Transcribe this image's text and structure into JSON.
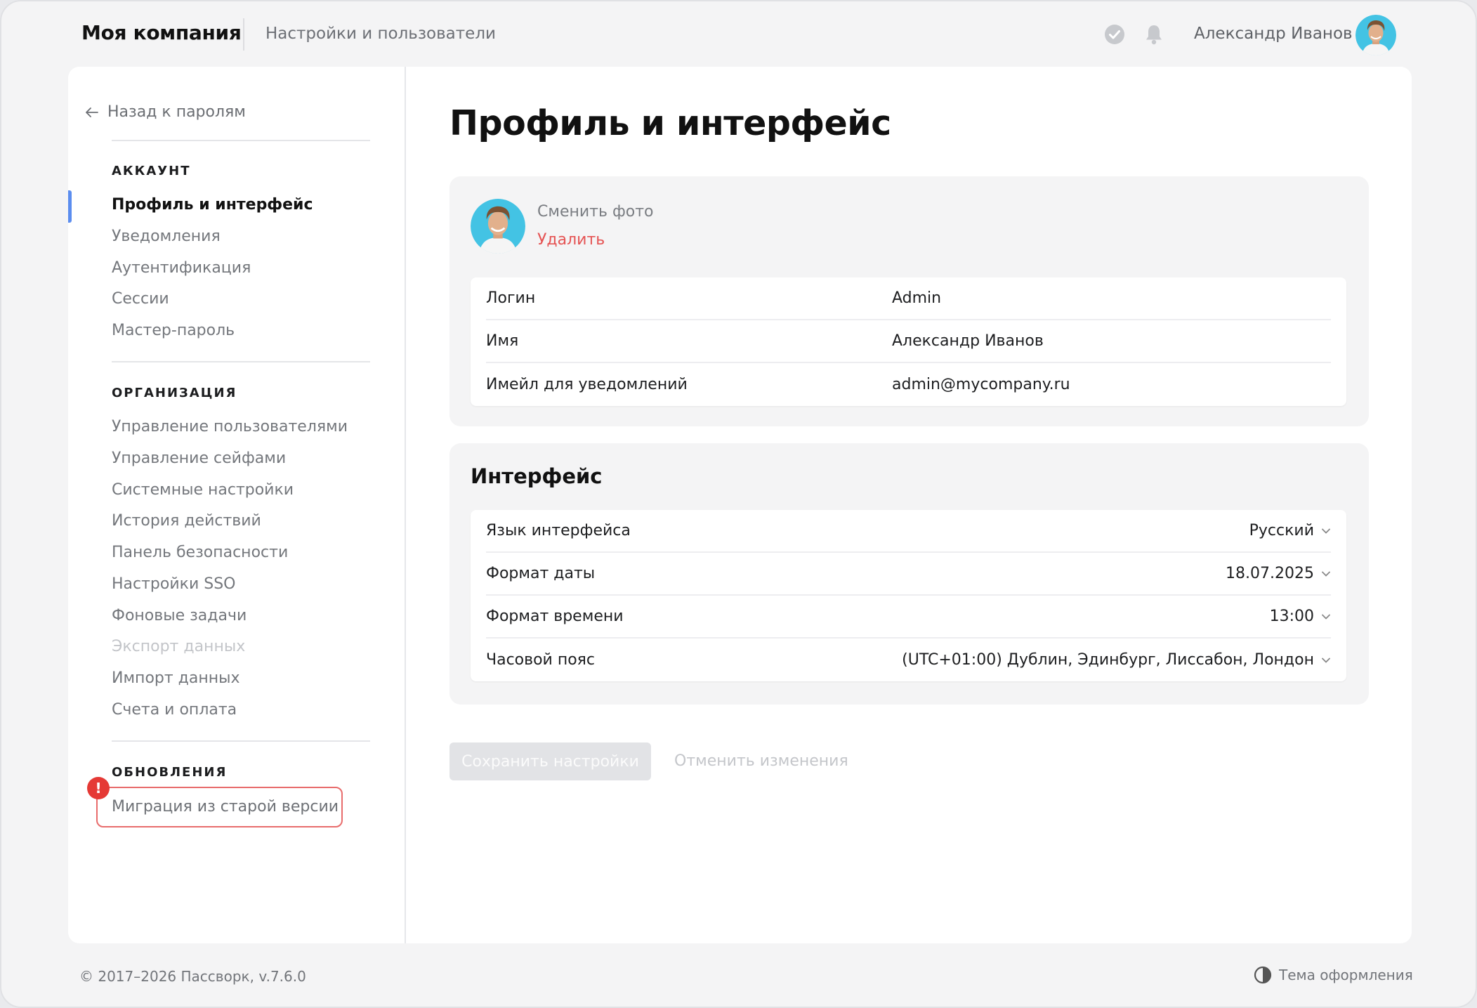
{
  "header": {
    "brand": "Моя компания",
    "subtitle": "Настройки и пользователи",
    "user_name": "Александр Иванов",
    "icons": [
      "check-circle-icon",
      "bell-icon",
      "avatar"
    ]
  },
  "sidebar": {
    "back_label": "Назад к паролям",
    "sections": {
      "account": {
        "title": "АККАУНТ",
        "items": [
          "Профиль и интерфейс",
          "Уведомления",
          "Аутентификация",
          "Сессии",
          "Мастер-пароль"
        ],
        "active_index": 0
      },
      "organization": {
        "title": "ОРГАНИЗАЦИЯ",
        "items": [
          "Управление пользователями",
          "Управление сейфами",
          "Системные настройки",
          "История действий",
          "Панель безопасности",
          "Настройки SSO",
          "Фоновые задачи",
          "Экспорт данных",
          "Импорт данных",
          "Счета и оплата"
        ],
        "disabled_index": 7
      },
      "updates": {
        "title": "ОБНОВЛЕНИЯ",
        "items": [
          "Миграция из старой версии"
        ],
        "badge": "!"
      }
    }
  },
  "main": {
    "title": "Профиль и интерфейс",
    "profile": {
      "change_photo": "Сменить фото",
      "delete_photo": "Удалить",
      "fields": [
        {
          "label": "Логин",
          "value": "Admin"
        },
        {
          "label": "Имя",
          "value": "Александр Иванов"
        },
        {
          "label": "Имейл для уведомлений",
          "value": "admin@mycompany.ru"
        }
      ]
    },
    "interface": {
      "heading": "Интерфейс",
      "settings": [
        {
          "label": "Язык интерфейса",
          "value": "Русский"
        },
        {
          "label": "Формат даты",
          "value": "18.07.2025"
        },
        {
          "label": "Формат времени",
          "value": "13:00"
        },
        {
          "label": "Часовой пояс",
          "value": "(UTC+01:00) Дублин, Эдинбург, Лиссабон, Лондон"
        }
      ]
    },
    "actions": {
      "save": "Сохранить настройки",
      "cancel": "Отменить изменения"
    }
  },
  "footer": {
    "copyright": "© 2017–2026 Пассворк, v.7.6.0",
    "theme": "Тема оформления"
  },
  "colors": {
    "accent": "#5b8def",
    "danger": "#e55353",
    "alert": "#e53935"
  }
}
